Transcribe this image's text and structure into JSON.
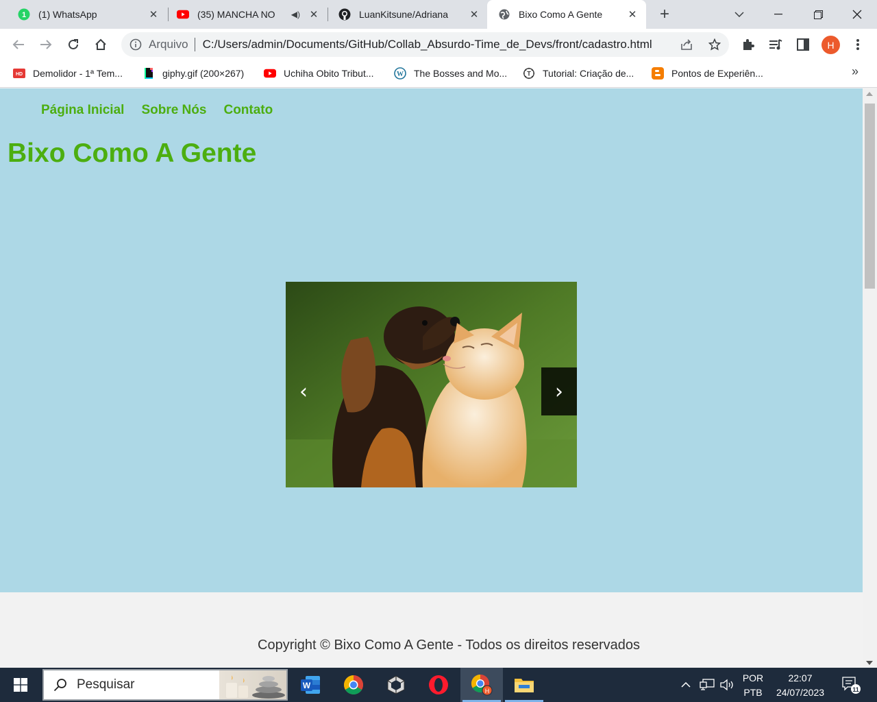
{
  "browser": {
    "tabs": [
      {
        "title": "(1) WhatsApp",
        "icon": "whatsapp-icon"
      },
      {
        "title": "(35) MANCHA NO",
        "icon": "youtube-icon"
      },
      {
        "title": "LuanKitsune/Adriana",
        "icon": "github-icon"
      },
      {
        "title": "Bixo Como A Gente",
        "icon": "globe-icon",
        "active": true
      }
    ],
    "whatsapp_badge": "1",
    "address": {
      "label": "Arquivo",
      "url": "C:/Users/admin/Documents/GitHub/Collab_Absurdo-Time_de_Devs/front/cadastro.html"
    },
    "profile_initial": "H",
    "bookmarks": [
      {
        "label": "Demolidor - 1ª Tem...",
        "icon": "hd-icon"
      },
      {
        "label": "giphy.gif (200×267)",
        "icon": "giphy-icon"
      },
      {
        "label": "Uchiha Obito Tribut...",
        "icon": "youtube-icon"
      },
      {
        "label": "The Bosses and Mo...",
        "icon": "wordpress-icon"
      },
      {
        "label": "Tutorial: Criação de...",
        "icon": "t-icon"
      },
      {
        "label": "Pontos de Experiên...",
        "icon": "blogger-icon"
      }
    ],
    "more_bookmarks": "»"
  },
  "site": {
    "nav": [
      "Página Inicial",
      "Sobre Nós",
      "Contato"
    ],
    "title": "Bixo Como A Gente",
    "carousel": {
      "prev": "‹",
      "next": "›",
      "image": "puppy-and-kitten-photo"
    },
    "footer": "Copyright © Bixo Como A Gente - Todos os direitos reservados"
  },
  "taskbar": {
    "search_placeholder": "Pesquisar",
    "apps": [
      "word-icon",
      "chrome-icon",
      "unity-icon",
      "opera-icon",
      "chrome-profile-icon",
      "file-explorer-icon"
    ],
    "lang_top": "POR",
    "lang_bottom": "PTB",
    "time": "22:07",
    "date": "24/07/2023",
    "notifications": "11"
  },
  "colors": {
    "site_bg": "#add8e6",
    "site_accent": "#4cae10",
    "taskbar": "#1e2b3c"
  }
}
